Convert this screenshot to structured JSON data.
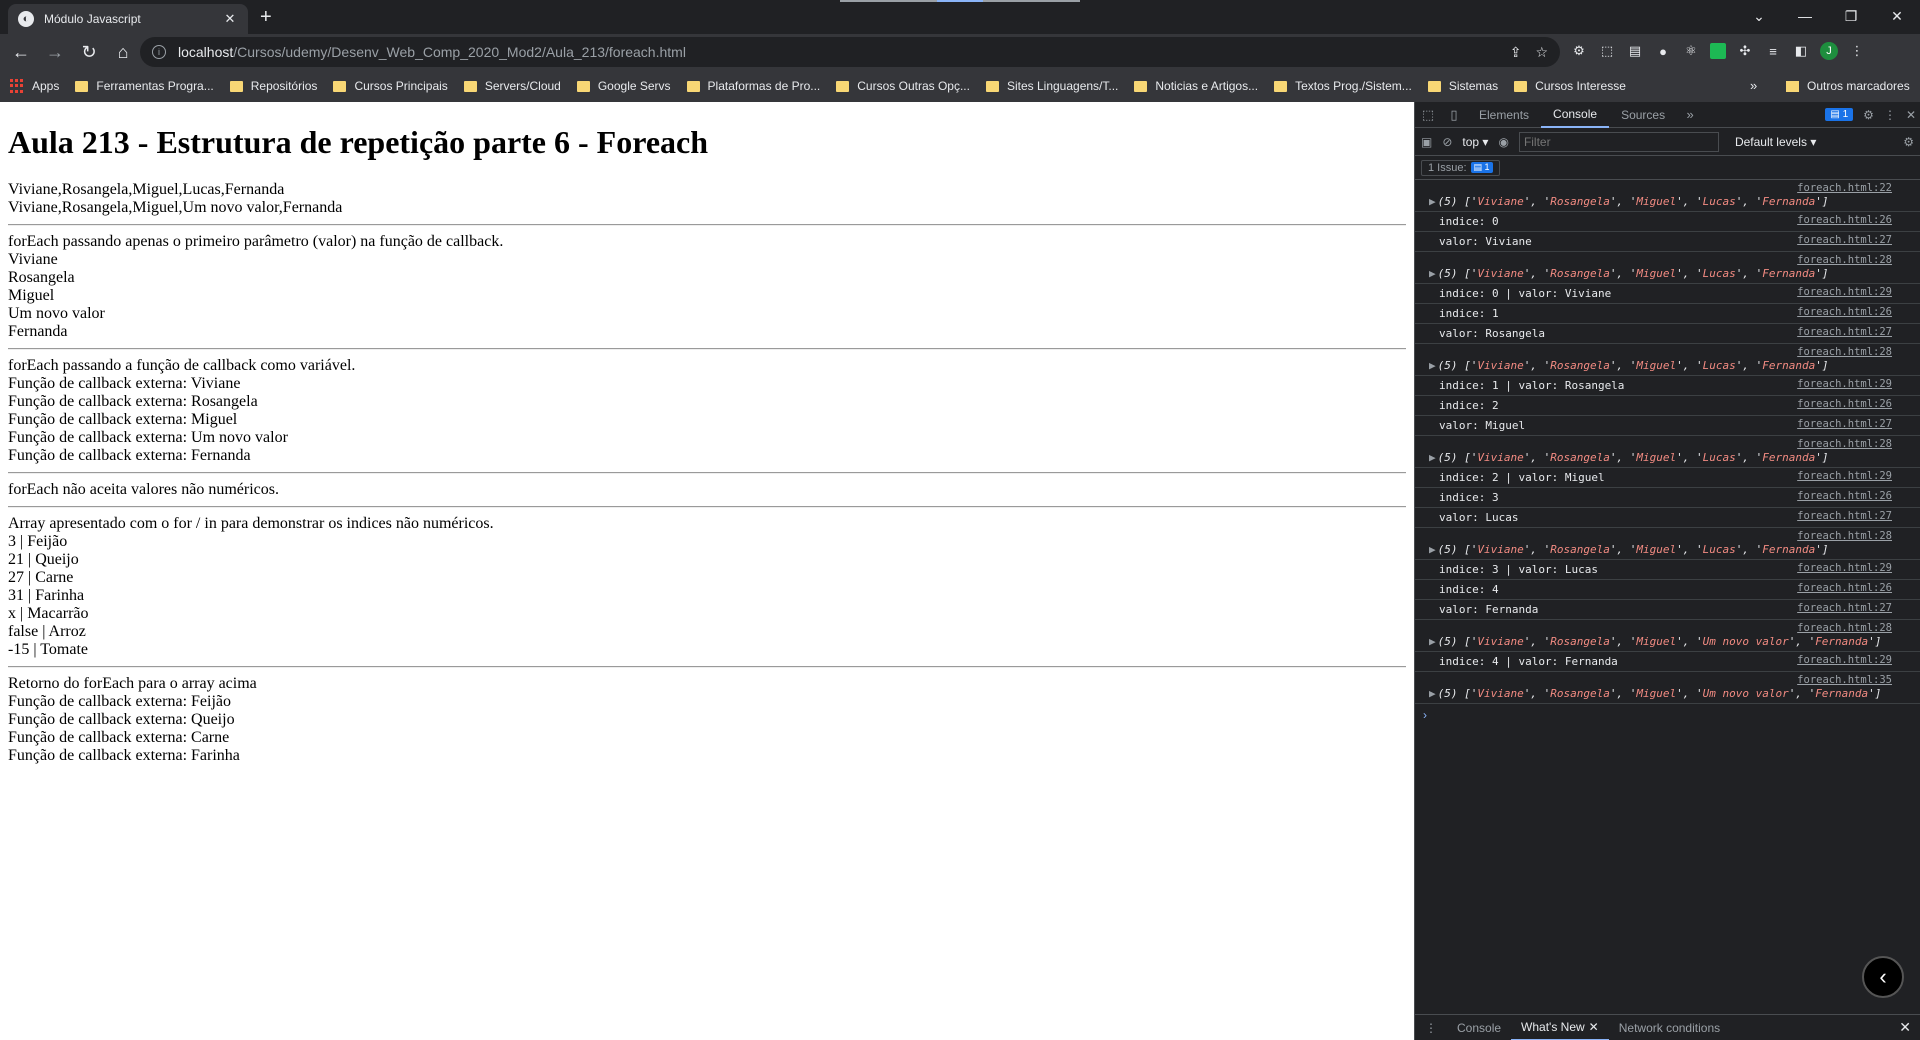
{
  "browser": {
    "tab_title": "Módulo Javascript",
    "url_host": "localhost",
    "url_path": "/Cursos/udemy/Desenv_Web_Comp_2020_Mod2/Aula_213/foreach.html",
    "profile_initial": "J"
  },
  "bookmarks": {
    "apps_label": "Apps",
    "items": [
      "Ferramentas Progra...",
      "Repositórios",
      "Cursos Principais",
      "Servers/Cloud",
      "Google Servs",
      "Plataformas de Pro...",
      "Cursos Outras Opç...",
      "Sites Linguagens/T...",
      "Noticias e Artigos...",
      "Textos Prog./Sistem...",
      "Sistemas",
      "Cursos Interesse"
    ],
    "more": "»",
    "other": "Outros marcadores"
  },
  "page": {
    "title": "Aula 213 - Estrutura de repetição parte 6 - Foreach",
    "section1": [
      "Viviane,Rosangela,Miguel,Lucas,Fernanda",
      "Viviane,Rosangela,Miguel,Um novo valor,Fernanda"
    ],
    "section2": [
      "forEach passando apenas o primeiro parâmetro (valor) na função de callback.",
      "Viviane",
      "Rosangela",
      "Miguel",
      "Um novo valor",
      "Fernanda"
    ],
    "section3": [
      "forEach passando a função de callback como variável.",
      "Função de callback externa: Viviane",
      "Função de callback externa: Rosangela",
      "Função de callback externa: Miguel",
      "Função de callback externa: Um novo valor",
      "Função de callback externa: Fernanda"
    ],
    "section4": [
      "forEach não aceita valores não numéricos."
    ],
    "section5": [
      "Array apresentado com o for / in para demonstrar os indices não numéricos.",
      "3 | Feijão",
      "21 | Queijo",
      "27 | Carne",
      "31 | Farinha",
      "x | Macarrão",
      "false | Arroz",
      "-15 | Tomate"
    ],
    "section6": [
      "Retorno do forEach para o array acima",
      "Função de callback externa: Feijão",
      "Função de callback externa: Queijo",
      "Função de callback externa: Carne",
      "Função de callback externa: Farinha"
    ]
  },
  "devtools": {
    "tabs": [
      "Elements",
      "Console",
      "Sources"
    ],
    "active_tab": "Console",
    "issues_badge": "1",
    "context": "top",
    "filter_placeholder": "Filter",
    "levels": "Default levels",
    "issues_label": "1 Issue:",
    "issues_count": "1",
    "drawer_tabs": [
      "Console",
      "What's New",
      "Network conditions"
    ],
    "console_rows": [
      {
        "type": "arr",
        "src": "foreach.html:22",
        "items": [
          "Viviane",
          "Rosangela",
          "Miguel",
          "Lucas",
          "Fernanda"
        ]
      },
      {
        "type": "log",
        "src": "foreach.html:26",
        "text": "indice: 0"
      },
      {
        "type": "log",
        "src": "foreach.html:27",
        "text": "valor: Viviane"
      },
      {
        "type": "arr",
        "src": "foreach.html:28",
        "items": [
          "Viviane",
          "Rosangela",
          "Miguel",
          "Lucas",
          "Fernanda"
        ]
      },
      {
        "type": "log",
        "src": "foreach.html:29",
        "text": "indice: 0 | valor: Viviane"
      },
      {
        "type": "log",
        "src": "foreach.html:26",
        "text": "indice: 1"
      },
      {
        "type": "log",
        "src": "foreach.html:27",
        "text": "valor: Rosangela"
      },
      {
        "type": "arr",
        "src": "foreach.html:28",
        "items": [
          "Viviane",
          "Rosangela",
          "Miguel",
          "Lucas",
          "Fernanda"
        ]
      },
      {
        "type": "log",
        "src": "foreach.html:29",
        "text": "indice: 1 | valor: Rosangela"
      },
      {
        "type": "log",
        "src": "foreach.html:26",
        "text": "indice: 2"
      },
      {
        "type": "log",
        "src": "foreach.html:27",
        "text": "valor: Miguel"
      },
      {
        "type": "arr",
        "src": "foreach.html:28",
        "items": [
          "Viviane",
          "Rosangela",
          "Miguel",
          "Lucas",
          "Fernanda"
        ]
      },
      {
        "type": "log",
        "src": "foreach.html:29",
        "text": "indice: 2 | valor: Miguel"
      },
      {
        "type": "log",
        "src": "foreach.html:26",
        "text": "indice: 3"
      },
      {
        "type": "log",
        "src": "foreach.html:27",
        "text": "valor: Lucas"
      },
      {
        "type": "arr",
        "src": "foreach.html:28",
        "items": [
          "Viviane",
          "Rosangela",
          "Miguel",
          "Lucas",
          "Fernanda"
        ]
      },
      {
        "type": "log",
        "src": "foreach.html:29",
        "text": "indice: 3 | valor: Lucas"
      },
      {
        "type": "log",
        "src": "foreach.html:26",
        "text": "indice: 4"
      },
      {
        "type": "log",
        "src": "foreach.html:27",
        "text": "valor: Fernanda"
      },
      {
        "type": "arr",
        "src": "foreach.html:28",
        "items": [
          "Viviane",
          "Rosangela",
          "Miguel",
          "Um novo valor",
          "Fernanda"
        ]
      },
      {
        "type": "log",
        "src": "foreach.html:29",
        "text": "indice: 4 | valor: Fernanda"
      },
      {
        "type": "arr",
        "src": "foreach.html:35",
        "items": [
          "Viviane",
          "Rosangela",
          "Miguel",
          "Um novo valor",
          "Fernanda"
        ]
      }
    ]
  }
}
